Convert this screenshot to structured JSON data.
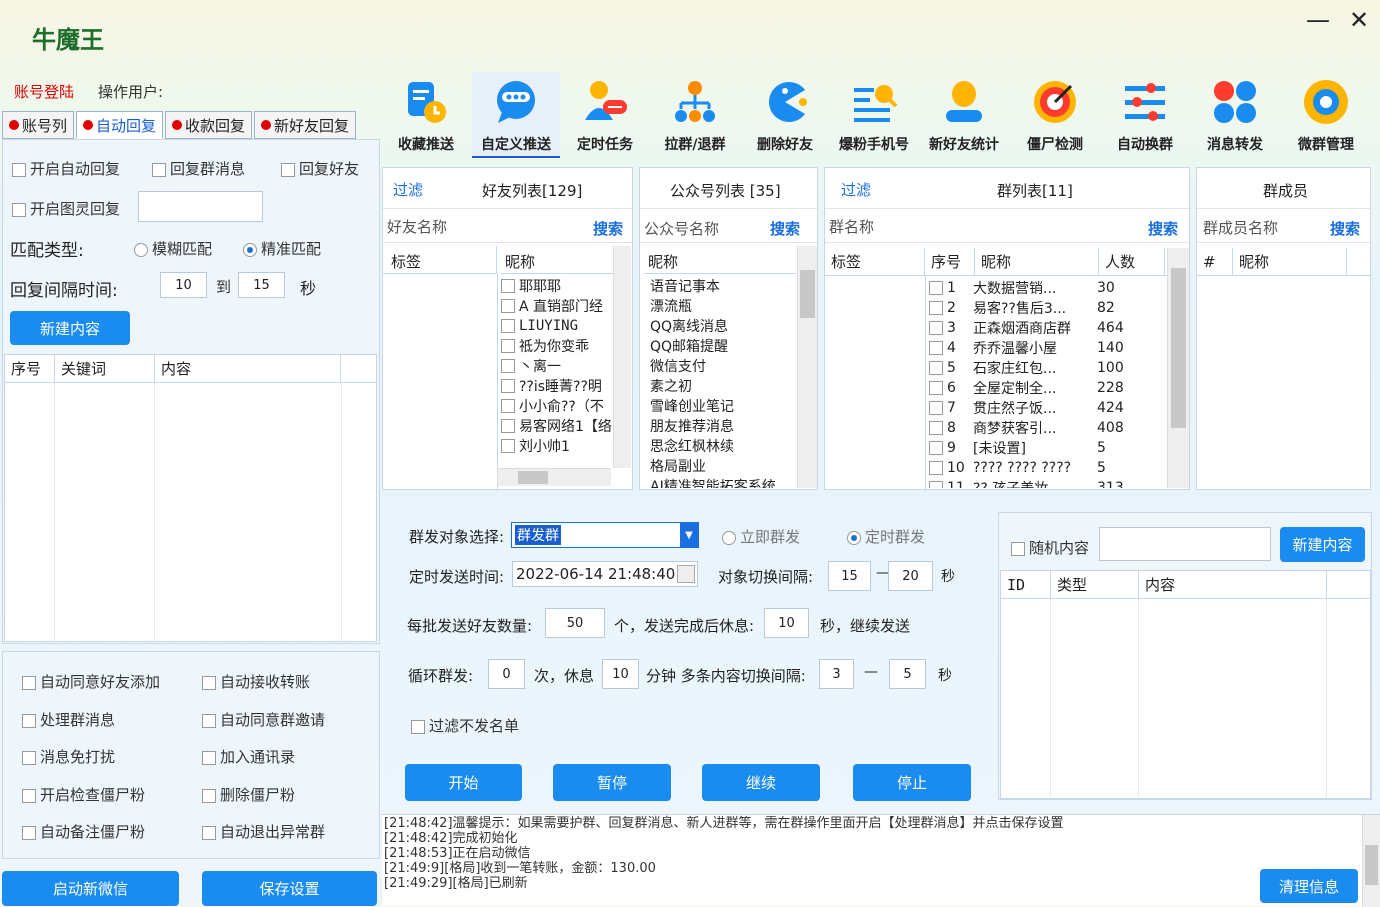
{
  "app": {
    "title": "牛魔王",
    "login": "账号登陆",
    "op_user": "操作用户:"
  },
  "left_tabs": [
    "账号列",
    "自动回复",
    "收款回复",
    "新好友回复"
  ],
  "reply": {
    "enable_auto": "开启自动回复",
    "reply_group": "回复群消息",
    "reply_friend": "回复好友",
    "enable_tuling": "开启图灵回复",
    "match_type": "匹配类型:",
    "fuzzy": "模糊匹配",
    "exact": "精准匹配",
    "interval_label": "回复间隔时间:",
    "interval_from": "10",
    "to": "到",
    "interval_to": "15",
    "sec": "秒",
    "new_btn": "新建内容",
    "cols": [
      "序号",
      "关键词",
      "内容"
    ]
  },
  "options": [
    [
      "自动同意好友添加",
      "自动接收转账"
    ],
    [
      "处理群消息",
      "自动同意群邀请"
    ],
    [
      "消息免打扰",
      "加入通讯录"
    ],
    [
      "开启检查僵尸粉",
      "删除僵尸粉"
    ],
    [
      "自动备注僵尸粉",
      "自动退出异常群"
    ]
  ],
  "bottom_btns": {
    "start_wechat": "启动新微信",
    "save": "保存设置"
  },
  "toolbar": [
    "收藏推送",
    "自定义推送",
    "定时任务",
    "拉群/退群",
    "删除好友",
    "爆粉手机号",
    "新好友统计",
    "僵尸检测",
    "自动换群",
    "消息转发",
    "微群管理"
  ],
  "friends": {
    "filter": "过滤",
    "title": "好友列表[129]",
    "name_col": "好友名称",
    "search": "搜索",
    "tag": "标签",
    "nick": "昵称",
    "rows": [
      "耶耶耶",
      "A  直销部门经",
      "LIUYING",
      "祗为你变乖",
      "丶离一",
      "??is睡菁??明",
      "小小俞??（不",
      "易客网络1【络",
      "刘小帅1"
    ]
  },
  "official": {
    "title": "公众号列表 [35]",
    "name_col": "公众号名称",
    "search": "搜索",
    "nick": "昵称",
    "rows": [
      "语音记事本",
      "漂流瓶",
      "QQ离线消息",
      "QQ邮箱提醒",
      "微信支付",
      "素之初",
      "雪峰创业笔记",
      "朋友推荐消息",
      "思念红枫林续",
      "格局副业",
      "AI精准智能拓客系统"
    ]
  },
  "groups": {
    "filter": "过滤",
    "title": "群列表[11]",
    "name_col": "群名称",
    "search": "搜索",
    "tag": "标签",
    "seq": "序号",
    "nick": "昵称",
    "count": "人数",
    "rows": [
      [
        "1",
        "大数据营销...",
        "30"
      ],
      [
        "2",
        "易客??售后3...",
        "82"
      ],
      [
        "3",
        "正森烟酒商店群",
        "464"
      ],
      [
        "4",
        "乔乔温馨小屋",
        "140"
      ],
      [
        "5",
        "石家庄红包...",
        "100"
      ],
      [
        "6",
        "全屋定制全...",
        "228"
      ],
      [
        "7",
        "贯庄然子饭...",
        "424"
      ],
      [
        "8",
        "商梦获客引...",
        "408"
      ],
      [
        "9",
        "[未设置]",
        "5"
      ],
      [
        "10",
        "???? ???? ????",
        "5"
      ],
      [
        "11",
        "?? 孩子美妆",
        "313"
      ]
    ]
  },
  "members": {
    "title": "群成员",
    "name_col": "群成员名称",
    "search": "搜索",
    "hash": "#",
    "nick": "昵称"
  },
  "send": {
    "target_label": "群发对象选择:",
    "target_value": "群发群",
    "now": "立即群发",
    "timed": "定时群发",
    "time_label": "定时发送时间:",
    "time_value": "2022-06-14 21:48:40",
    "switch_label": "对象切换间隔:",
    "switch_from": "15",
    "dash": "—",
    "switch_to": "20",
    "sec": "秒",
    "batch_label": "每批发送好友数量:",
    "batch_value": "50",
    "batch_mid": "个，发送完成后休息:",
    "rest_value": "10",
    "batch_end": "秒，继续发送",
    "loop_label": "循环群发:",
    "loop_value": "0",
    "loop_mid": "次，休息",
    "loop_rest": "10",
    "loop_min": "分钟  多条内容切换间隔:",
    "c_from": "3",
    "c_to": "5",
    "filter_label": "过滤不发名单",
    "buttons": [
      "开始",
      "暂停",
      "继续",
      "停止"
    ]
  },
  "content": {
    "random": "随机内容",
    "new_btn": "新建内容",
    "cols": [
      "ID",
      "类型",
      "内容"
    ]
  },
  "log": {
    "lines": [
      "[21:48:42]温馨提示：如果需要护群、回复群消息、新人进群等，需在群操作里面开启【处理群消息】并点击保存设置",
      "[21:48:42]完成初始化",
      "[21:48:53]正在启动微信",
      "[21:49:9][格局]收到一笔转账，金额：130.00",
      "[21:49:29][格局]已刷新"
    ],
    "clear_btn": "清理信息"
  },
  "colors": {
    "accent": "#1a8cf0",
    "red": "#e00000",
    "link": "#1a6fe0"
  }
}
